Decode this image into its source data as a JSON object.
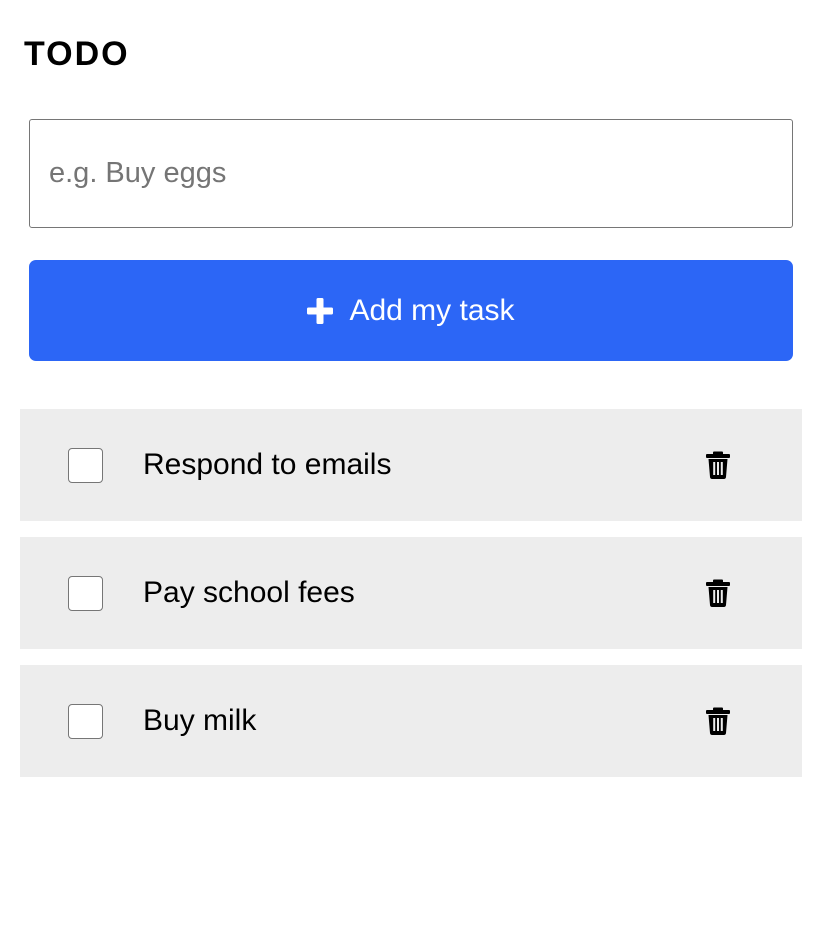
{
  "header": {
    "title": "TODO"
  },
  "form": {
    "input_placeholder": "e.g. Buy eggs",
    "input_value": "",
    "add_button_label": "Add my task",
    "add_button_icon": "plus-icon",
    "accent_color": "#2c66f6"
  },
  "tasks": [
    {
      "label": "Respond to emails",
      "done": false,
      "delete_icon": "trash-icon"
    },
    {
      "label": "Pay school fees",
      "done": false,
      "delete_icon": "trash-icon"
    },
    {
      "label": "Buy milk",
      "done": false,
      "delete_icon": "trash-icon"
    }
  ],
  "colors": {
    "row_background": "#ededed",
    "checkbox_border": "#767676"
  }
}
